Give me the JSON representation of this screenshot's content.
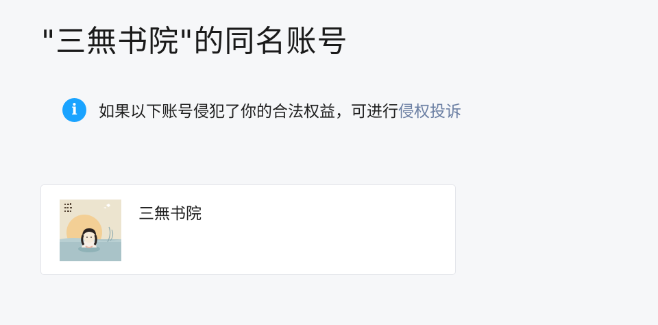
{
  "page": {
    "title": "\"三無书院\"的同名账号"
  },
  "notice": {
    "icon": "info-icon",
    "icon_glyph": "i",
    "text": "如果以下账号侵犯了你的合法权益，可进行",
    "link_label": "侵权投诉"
  },
  "accounts": [
    {
      "name": "三無书院",
      "avatar_icon": "illustrated-avatar"
    }
  ],
  "colors": {
    "background": "#f6f7f9",
    "info_icon": "#1aa3ff",
    "link": "#6b7fa3",
    "card_background": "#ffffff",
    "card_border": "#e3e5ea"
  }
}
